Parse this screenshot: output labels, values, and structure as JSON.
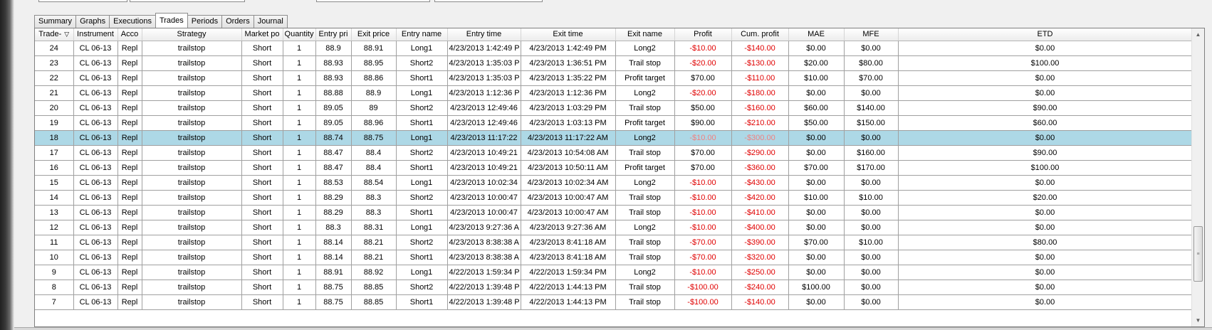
{
  "tabs": [
    {
      "label": "Summary",
      "active": false
    },
    {
      "label": "Graphs",
      "active": false
    },
    {
      "label": "Executions",
      "active": false
    },
    {
      "label": "Trades",
      "active": true
    },
    {
      "label": "Periods",
      "active": false
    },
    {
      "label": "Orders",
      "active": false
    },
    {
      "label": "Journal",
      "active": false
    }
  ],
  "columns": [
    "Trade-",
    "Instrument",
    "Acco",
    "Strategy",
    "Market po",
    "Quantity",
    "Entry pri",
    "Exit price",
    "Entry name",
    "Entry time",
    "Exit time",
    "Exit name",
    "Profit",
    "Cum. profit",
    "MAE",
    "MFE",
    "ETD"
  ],
  "sort_indicator": "▽",
  "colors": {
    "selected_row": "#add8e6",
    "negative": "#e00000",
    "selected_negative": "#f08080"
  },
  "rows": [
    {
      "values": [
        "24",
        "CL 06-13",
        "Repl",
        "trailstop",
        "Short",
        "1",
        "88.9",
        "88.91",
        "Long1",
        "4/23/2013 1:42:49 P",
        "4/23/2013 1:42:49 PM",
        "Long2",
        "-$10.00",
        "-$140.00",
        "$0.00",
        "$0.00",
        "$0.00"
      ]
    },
    {
      "values": [
        "23",
        "CL 06-13",
        "Repl",
        "trailstop",
        "Short",
        "1",
        "88.93",
        "88.95",
        "Short2",
        "4/23/2013 1:35:03 P",
        "4/23/2013 1:36:51 PM",
        "Trail stop",
        "-$20.00",
        "-$130.00",
        "$20.00",
        "$80.00",
        "$100.00"
      ]
    },
    {
      "values": [
        "22",
        "CL 06-13",
        "Repl",
        "trailstop",
        "Short",
        "1",
        "88.93",
        "88.86",
        "Short1",
        "4/23/2013 1:35:03 P",
        "4/23/2013 1:35:22 PM",
        "Profit target",
        "$70.00",
        "-$110.00",
        "$10.00",
        "$70.00",
        "$0.00"
      ]
    },
    {
      "values": [
        "21",
        "CL 06-13",
        "Repl",
        "trailstop",
        "Short",
        "1",
        "88.88",
        "88.9",
        "Long1",
        "4/23/2013 1:12:36 P",
        "4/23/2013 1:12:36 PM",
        "Long2",
        "-$20.00",
        "-$180.00",
        "$0.00",
        "$0.00",
        "$0.00"
      ]
    },
    {
      "values": [
        "20",
        "CL 06-13",
        "Repl",
        "trailstop",
        "Short",
        "1",
        "89.05",
        "89",
        "Short2",
        "4/23/2013 12:49:46",
        "4/23/2013 1:03:29 PM",
        "Trail stop",
        "$50.00",
        "-$160.00",
        "$60.00",
        "$140.00",
        "$90.00"
      ]
    },
    {
      "values": [
        "19",
        "CL 06-13",
        "Repl",
        "trailstop",
        "Short",
        "1",
        "89.05",
        "88.96",
        "Short1",
        "4/23/2013 12:49:46",
        "4/23/2013 1:03:13 PM",
        "Profit target",
        "$90.00",
        "-$210.00",
        "$50.00",
        "$150.00",
        "$60.00"
      ]
    },
    {
      "values": [
        "18",
        "CL 06-13",
        "Repl",
        "trailstop",
        "Short",
        "1",
        "88.74",
        "88.75",
        "Long1",
        "4/23/2013 11:17:22",
        "4/23/2013 11:17:22 AM",
        "Long2",
        "-$10.00",
        "-$300.00",
        "$0.00",
        "$0.00",
        "$0.00"
      ],
      "selected": true
    },
    {
      "values": [
        "17",
        "CL 06-13",
        "Repl",
        "trailstop",
        "Short",
        "1",
        "88.47",
        "88.4",
        "Short2",
        "4/23/2013 10:49:21",
        "4/23/2013 10:54:08 AM",
        "Trail stop",
        "$70.00",
        "-$290.00",
        "$0.00",
        "$160.00",
        "$90.00"
      ]
    },
    {
      "values": [
        "16",
        "CL 06-13",
        "Repl",
        "trailstop",
        "Short",
        "1",
        "88.47",
        "88.4",
        "Short1",
        "4/23/2013 10:49:21",
        "4/23/2013 10:50:11 AM",
        "Profit target",
        "$70.00",
        "-$360.00",
        "$70.00",
        "$170.00",
        "$100.00"
      ]
    },
    {
      "values": [
        "15",
        "CL 06-13",
        "Repl",
        "trailstop",
        "Short",
        "1",
        "88.53",
        "88.54",
        "Long1",
        "4/23/2013 10:02:34",
        "4/23/2013 10:02:34 AM",
        "Long2",
        "-$10.00",
        "-$430.00",
        "$0.00",
        "$0.00",
        "$0.00"
      ]
    },
    {
      "values": [
        "14",
        "CL 06-13",
        "Repl",
        "trailstop",
        "Short",
        "1",
        "88.29",
        "88.3",
        "Short2",
        "4/23/2013 10:00:47",
        "4/23/2013 10:00:47 AM",
        "Trail stop",
        "-$10.00",
        "-$420.00",
        "$10.00",
        "$10.00",
        "$20.00"
      ]
    },
    {
      "values": [
        "13",
        "CL 06-13",
        "Repl",
        "trailstop",
        "Short",
        "1",
        "88.29",
        "88.3",
        "Short1",
        "4/23/2013 10:00:47",
        "4/23/2013 10:00:47 AM",
        "Trail stop",
        "-$10.00",
        "-$410.00",
        "$0.00",
        "$0.00",
        "$0.00"
      ]
    },
    {
      "values": [
        "12",
        "CL 06-13",
        "Repl",
        "trailstop",
        "Short",
        "1",
        "88.3",
        "88.31",
        "Long1",
        "4/23/2013 9:27:36 A",
        "4/23/2013 9:27:36 AM",
        "Long2",
        "-$10.00",
        "-$400.00",
        "$0.00",
        "$0.00",
        "$0.00"
      ]
    },
    {
      "values": [
        "11",
        "CL 06-13",
        "Repl",
        "trailstop",
        "Short",
        "1",
        "88.14",
        "88.21",
        "Short2",
        "4/23/2013 8:38:38 A",
        "4/23/2013 8:41:18 AM",
        "Trail stop",
        "-$70.00",
        "-$390.00",
        "$70.00",
        "$10.00",
        "$80.00"
      ]
    },
    {
      "values": [
        "10",
        "CL 06-13",
        "Repl",
        "trailstop",
        "Short",
        "1",
        "88.14",
        "88.21",
        "Short1",
        "4/23/2013 8:38:38 A",
        "4/23/2013 8:41:18 AM",
        "Trail stop",
        "-$70.00",
        "-$320.00",
        "$0.00",
        "$0.00",
        "$0.00"
      ]
    },
    {
      "values": [
        "9",
        "CL 06-13",
        "Repl",
        "trailstop",
        "Short",
        "1",
        "88.91",
        "88.92",
        "Long1",
        "4/22/2013 1:59:34 P",
        "4/22/2013 1:59:34 PM",
        "Long2",
        "-$10.00",
        "-$250.00",
        "$0.00",
        "$0.00",
        "$0.00"
      ]
    },
    {
      "values": [
        "8",
        "CL 06-13",
        "Repl",
        "trailstop",
        "Short",
        "1",
        "88.75",
        "88.85",
        "Short2",
        "4/22/2013 1:39:48 P",
        "4/22/2013 1:44:13 PM",
        "Trail stop",
        "-$100.00",
        "-$240.00",
        "$100.00",
        "$0.00",
        "$0.00"
      ]
    },
    {
      "values": [
        "7",
        "CL 06-13",
        "Repl",
        "trailstop",
        "Short",
        "1",
        "88.75",
        "88.85",
        "Short1",
        "4/22/2013 1:39:48 P",
        "4/22/2013 1:44:13 PM",
        "Trail stop",
        "-$100.00",
        "-$140.00",
        "$0.00",
        "$0.00",
        "$0.00"
      ]
    }
  ]
}
